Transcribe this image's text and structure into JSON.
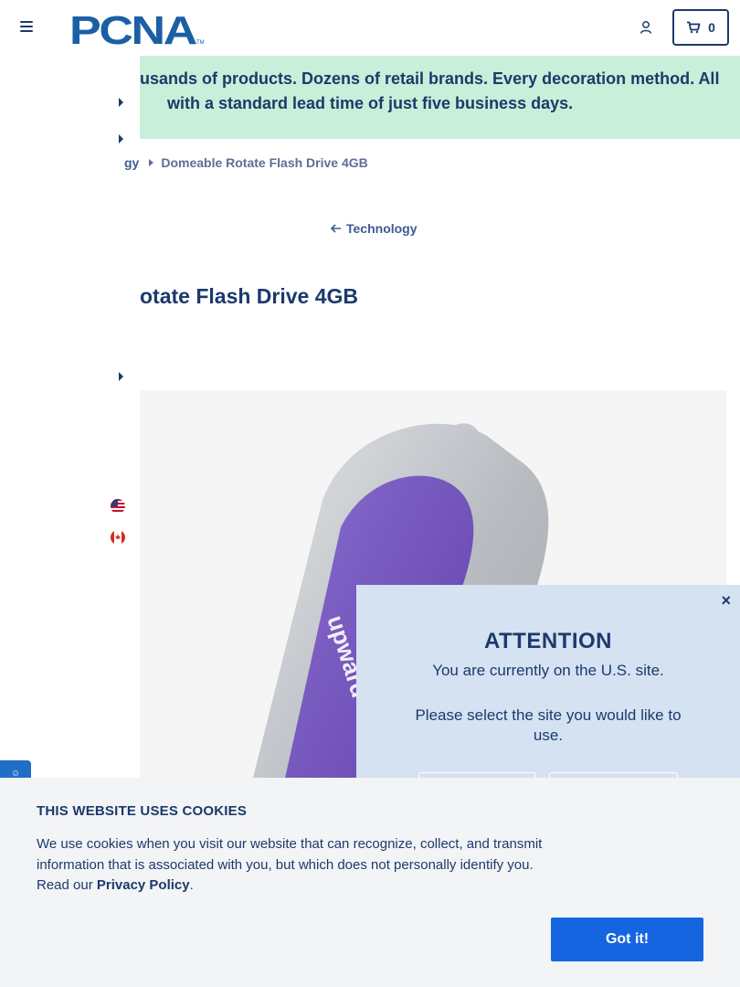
{
  "header": {
    "logo_text": "PCNA",
    "cart_count": "0"
  },
  "promo": {
    "line1": "usands of products. Dozens of retail brands. Every decoration method. All",
    "line2": "with a standard lead time of just five business days."
  },
  "breadcrumb": {
    "items": [
      "gy",
      "Domeable Rotate Flash Drive 4GB"
    ]
  },
  "back_link": {
    "label": "Technology"
  },
  "product": {
    "title": "otate Flash Drive 4GB",
    "image_imprint": "upward stream"
  },
  "region_modal": {
    "title": "ATTENTION",
    "line1": "You are currently on the U.S. site.",
    "line2": "Please select the site you would like to use.",
    "close": "×"
  },
  "cookie_banner": {
    "title": "THIS WEBSITE USES COOKIES",
    "text": "We use cookies when you visit our website that can recognize, collect, and transmit information that is associated with you, but which does not personally identify you. Read our ",
    "link_label": "Privacy Policy",
    "text_end": ".",
    "button_label": "Got it!"
  },
  "colors": {
    "brand_navy": "#1b3a6b",
    "promo_bg": "#c9eed9",
    "modal_bg": "#d5e2f2",
    "cookie_button": "#1565e0"
  }
}
